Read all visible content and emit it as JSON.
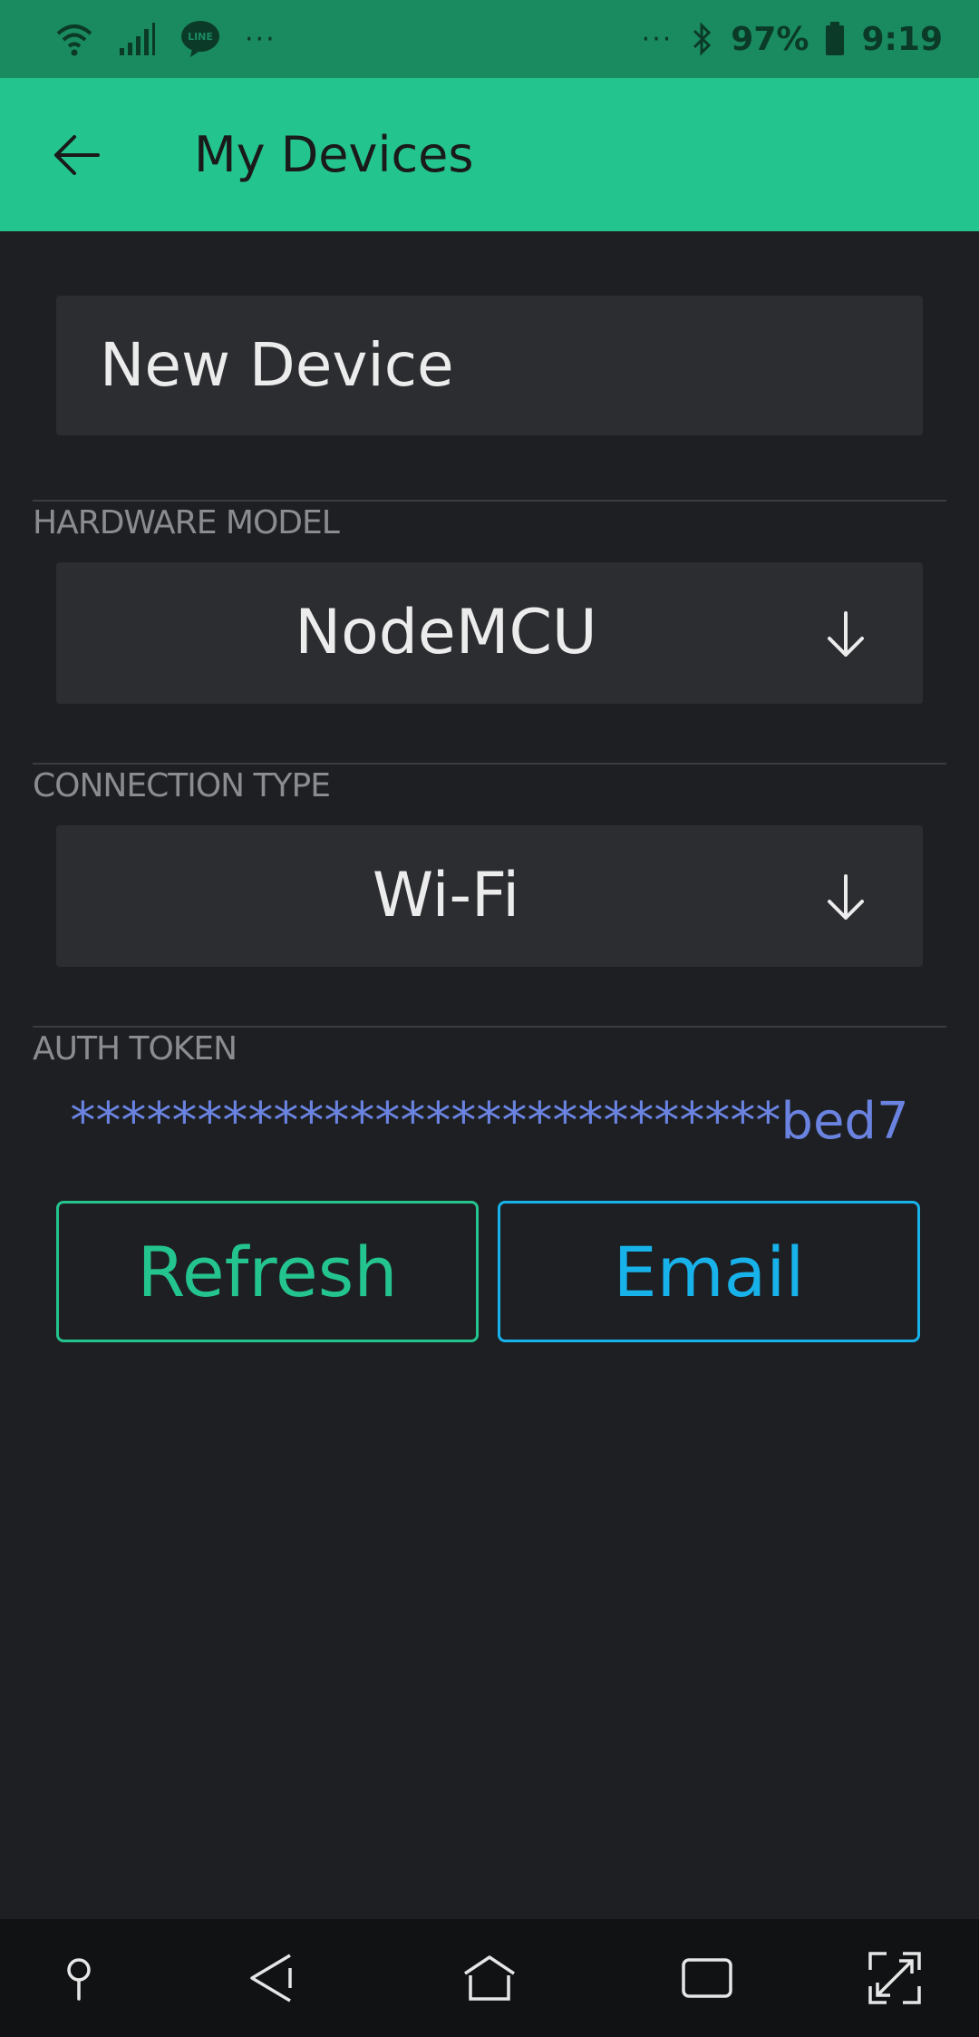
{
  "status_bar": {
    "left_dots": "···",
    "right_dots": "···",
    "battery": "97%",
    "time": "9:19",
    "icons": [
      "wifi-icon",
      "signal-icon",
      "line-app-icon",
      "bluetooth-icon",
      "battery-icon"
    ]
  },
  "app_bar": {
    "title": "My Devices",
    "back_icon": "arrow-left-icon",
    "color": "#24c48e"
  },
  "device_name": {
    "value": "New Device"
  },
  "hardware_model": {
    "label": "HARDWARE MODEL",
    "value": "NodeMCU",
    "icon": "arrow-down-icon"
  },
  "connection_type": {
    "label": "CONNECTION TYPE",
    "value": "Wi-Fi",
    "icon": "arrow-down-icon"
  },
  "auth_token": {
    "label": "AUTH TOKEN",
    "masked": "****************************",
    "suffix": "bed7"
  },
  "actions": {
    "refresh_label": "Refresh",
    "email_label": "Email",
    "refresh_color": "#24c48e",
    "email_color": "#18b2ea"
  },
  "nav_bar": {
    "icons": [
      "pin-icon",
      "back-icon",
      "home-icon",
      "recents-icon",
      "expand-icon"
    ]
  }
}
